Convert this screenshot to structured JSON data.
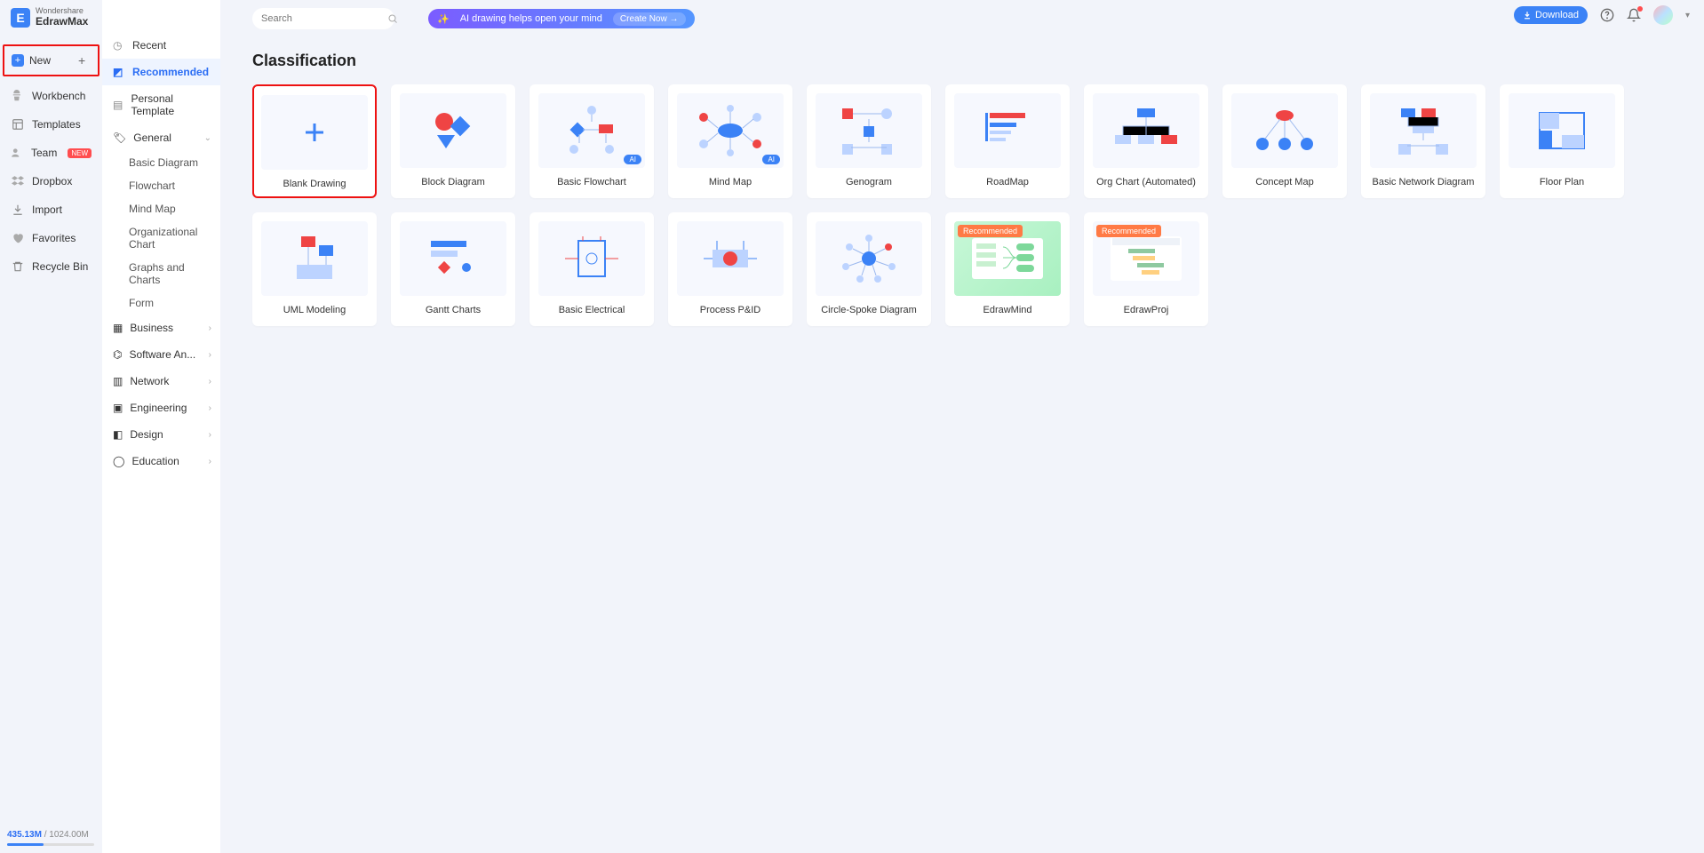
{
  "brand": {
    "top": "Wondershare",
    "name": "EdrawMax"
  },
  "leftnav": {
    "new": "New",
    "items": [
      {
        "label": "Workbench"
      },
      {
        "label": "Templates"
      },
      {
        "label": "Team",
        "badge": "NEW"
      },
      {
        "label": "Dropbox"
      },
      {
        "label": "Import"
      },
      {
        "label": "Favorites"
      },
      {
        "label": "Recycle Bin"
      }
    ]
  },
  "sidepanel": {
    "top": [
      {
        "label": "Recent"
      },
      {
        "label": "Recommended",
        "active": true
      },
      {
        "label": "Personal Template"
      }
    ],
    "general": {
      "label": "General",
      "subs": [
        "Basic Diagram",
        "Flowchart",
        "Mind Map",
        "Organizational Chart",
        "Graphs and Charts",
        "Form"
      ]
    },
    "groups": [
      "Business",
      "Software An...",
      "Network",
      "Engineering",
      "Design",
      "Education"
    ]
  },
  "search": {
    "placeholder": "Search"
  },
  "banner": {
    "text": "AI drawing helps open your mind",
    "cta": "Create Now  →"
  },
  "topright": {
    "download": "Download"
  },
  "page": {
    "title": "Classification"
  },
  "ai_tag": "AI",
  "rec_tag": "Recommended",
  "cards": [
    {
      "label": "Blank Drawing",
      "type": "blank",
      "highlight": true
    },
    {
      "label": "Block Diagram",
      "type": "block"
    },
    {
      "label": "Basic Flowchart",
      "type": "flow",
      "ai": true
    },
    {
      "label": "Mind Map",
      "type": "mind",
      "ai": true
    },
    {
      "label": "Genogram",
      "type": "geno"
    },
    {
      "label": "RoadMap",
      "type": "road"
    },
    {
      "label": "Org Chart (Automated)",
      "type": "org"
    },
    {
      "label": "Concept Map",
      "type": "concept"
    },
    {
      "label": "Basic Network Diagram",
      "type": "net"
    },
    {
      "label": "Floor Plan",
      "type": "floor"
    },
    {
      "label": "UML Modeling",
      "type": "uml"
    },
    {
      "label": "Gantt Charts",
      "type": "gantt"
    },
    {
      "label": "Basic Electrical",
      "type": "elec"
    },
    {
      "label": "Process P&ID",
      "type": "pid"
    },
    {
      "label": "Circle-Spoke Diagram",
      "type": "spoke"
    },
    {
      "label": "EdrawMind",
      "type": "edrawmind",
      "rec": true
    },
    {
      "label": "EdrawProj",
      "type": "edrawproj",
      "rec": true
    }
  ],
  "storage": {
    "used": "435.13M",
    "total": "1024.00M",
    "pct": 42
  }
}
